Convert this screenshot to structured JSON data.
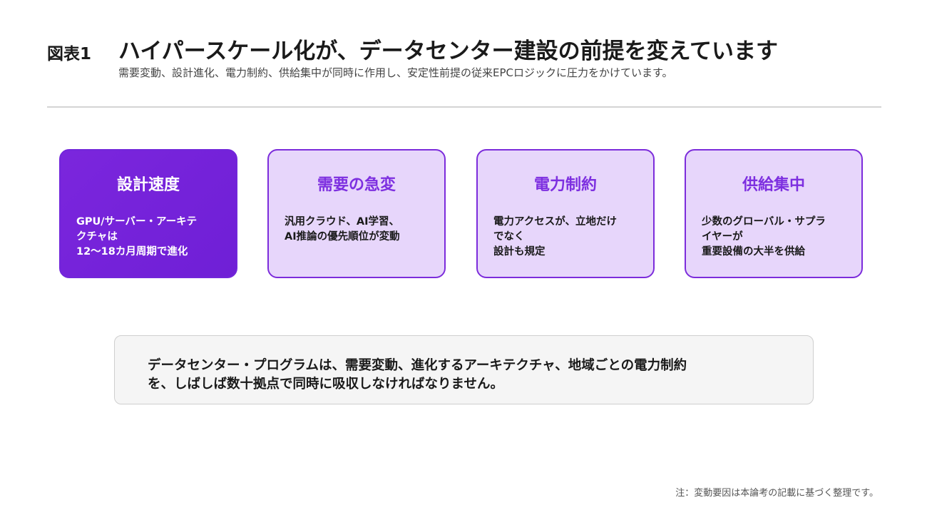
{
  "header": {
    "figure_label": "図表1",
    "title": "ハイパースケール化が、データセンター建設の前提を変えています",
    "subtitle": "需要変動、設計進化、電力制約、供給集中が同時に作用し、安定性前提の従来EPCロジックに圧力をかけています。"
  },
  "cards": [
    {
      "title": "設計速度",
      "body": "GPU/サーバー・アーキテ\nクチャは\n12〜18カ月周期で進化",
      "style": "primary"
    },
    {
      "title": "需要の急変",
      "body": "汎用クラウド、AI学習、\nAI推論の優先順位が変動",
      "style": "secondary"
    },
    {
      "title": "電力制約",
      "body": "電力アクセスが、立地だけ\nでなく\n設計も規定",
      "style": "secondary"
    },
    {
      "title": "供給集中",
      "body": "少数のグローバル・サプラ\nイヤーが\n重要設備の大半を供給",
      "style": "secondary"
    }
  ],
  "callout": {
    "text": "データセンター・プログラムは、需要変動、進化するアーキテクチャ、地域ごとの電力制約\nを、しばしば数十拠点で同時に吸収しなければなりません。"
  },
  "footer": {
    "note": "注：変動要因は本論考の記載に基づく整理です。"
  },
  "colors": {
    "accent": "#7c2cdb",
    "card_fill": "#e7d6fb",
    "primary_fill": "#7226da"
  }
}
